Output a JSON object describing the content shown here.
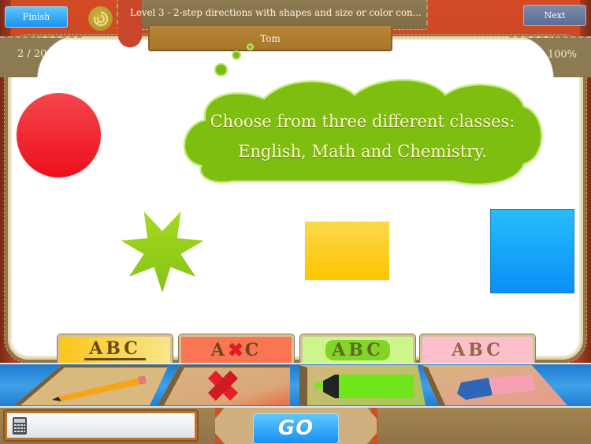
{
  "header": {
    "finish_label": "Finish",
    "next_label": "Next",
    "replay_icon": "replay-icon",
    "title": "Level 3 - 2-step directions with shapes and size or color con...",
    "player_name": "Tom",
    "progress": "2 / 20",
    "score_percent": "100%"
  },
  "instruction": {
    "lines": [
      "Choose from three different classes:",
      "English, Math and Chemistry."
    ]
  },
  "shapes": [
    {
      "type": "circle",
      "color": "#ef1d26",
      "name": "red-circle"
    },
    {
      "type": "star",
      "points": 7,
      "color": "#8fcc1a",
      "name": "green-star"
    },
    {
      "type": "rectangle",
      "color": "#fdc90f",
      "name": "yellow-rectangle"
    },
    {
      "type": "square",
      "color": "#169df8",
      "name": "blue-square"
    }
  ],
  "style_tabs": [
    {
      "name": "underline",
      "label": "ABC",
      "color": "#fdc51a"
    },
    {
      "name": "strikethrough",
      "label_a": "A",
      "label_c": "C",
      "color": "#fa7551"
    },
    {
      "name": "highlight",
      "label": "ABC",
      "color": "#ccf58a"
    },
    {
      "name": "erase",
      "label": "ABC",
      "color": "#fdc0cb"
    }
  ],
  "tools": [
    {
      "name": "pencil",
      "icon": "pencil-icon"
    },
    {
      "name": "cross",
      "icon": "x-mark-icon"
    },
    {
      "name": "highlighter",
      "icon": "highlighter-icon"
    },
    {
      "name": "eraser",
      "icon": "eraser-icon"
    }
  ],
  "footer": {
    "answer_value": "",
    "calculator_icon": "calculator-icon",
    "go_label": "GO"
  },
  "colors": {
    "accent_blue": "#1b93f0",
    "frame_red": "#c9462a",
    "leather_brown": "#8c7a52",
    "cloud_green": "#7cbd13"
  }
}
